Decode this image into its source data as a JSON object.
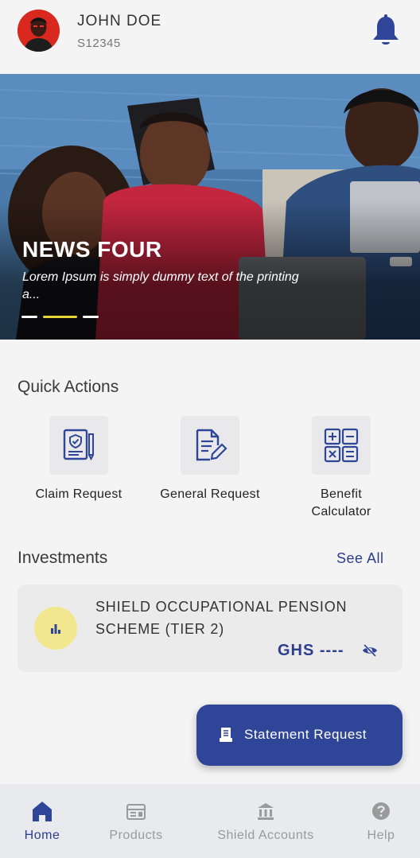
{
  "header": {
    "user_name": "JOHN DOE",
    "user_id": "S12345"
  },
  "banner": {
    "title": "NEWS FOUR",
    "text": "Lorem Ipsum is simply dummy text of the printing a...",
    "slides_count": 3,
    "active_slide": 2
  },
  "quick_actions": {
    "title": "Quick Actions",
    "items": [
      {
        "label": "Claim Request",
        "icon": "document-shield-icon"
      },
      {
        "label": "General Request",
        "icon": "document-edit-icon"
      },
      {
        "label": "Benefit Calculator",
        "icon": "calculator-icon"
      }
    ]
  },
  "investments": {
    "title": "Investments",
    "see_all_label": "See All",
    "items": [
      {
        "name": "SHIELD OCCUPATIONAL PENSION SCHEME (TIER 2)",
        "amount": "GHS ----",
        "icon": "bar-chart-icon"
      }
    ]
  },
  "fab": {
    "label": "Statement Request",
    "icon": "statement-icon"
  },
  "bottom_nav": {
    "items": [
      {
        "label": "Home",
        "icon": "home-icon",
        "active": true
      },
      {
        "label": "Products",
        "icon": "products-icon",
        "active": false
      },
      {
        "label": "Shield Accounts",
        "icon": "bank-icon",
        "active": false
      },
      {
        "label": "Help",
        "icon": "help-icon",
        "active": false
      }
    ]
  },
  "colors": {
    "primary": "#2f4698",
    "accent_yellow": "#f2e78f",
    "avatar_red": "#d9291f",
    "slide_indicator_active": "#e7d63a"
  }
}
